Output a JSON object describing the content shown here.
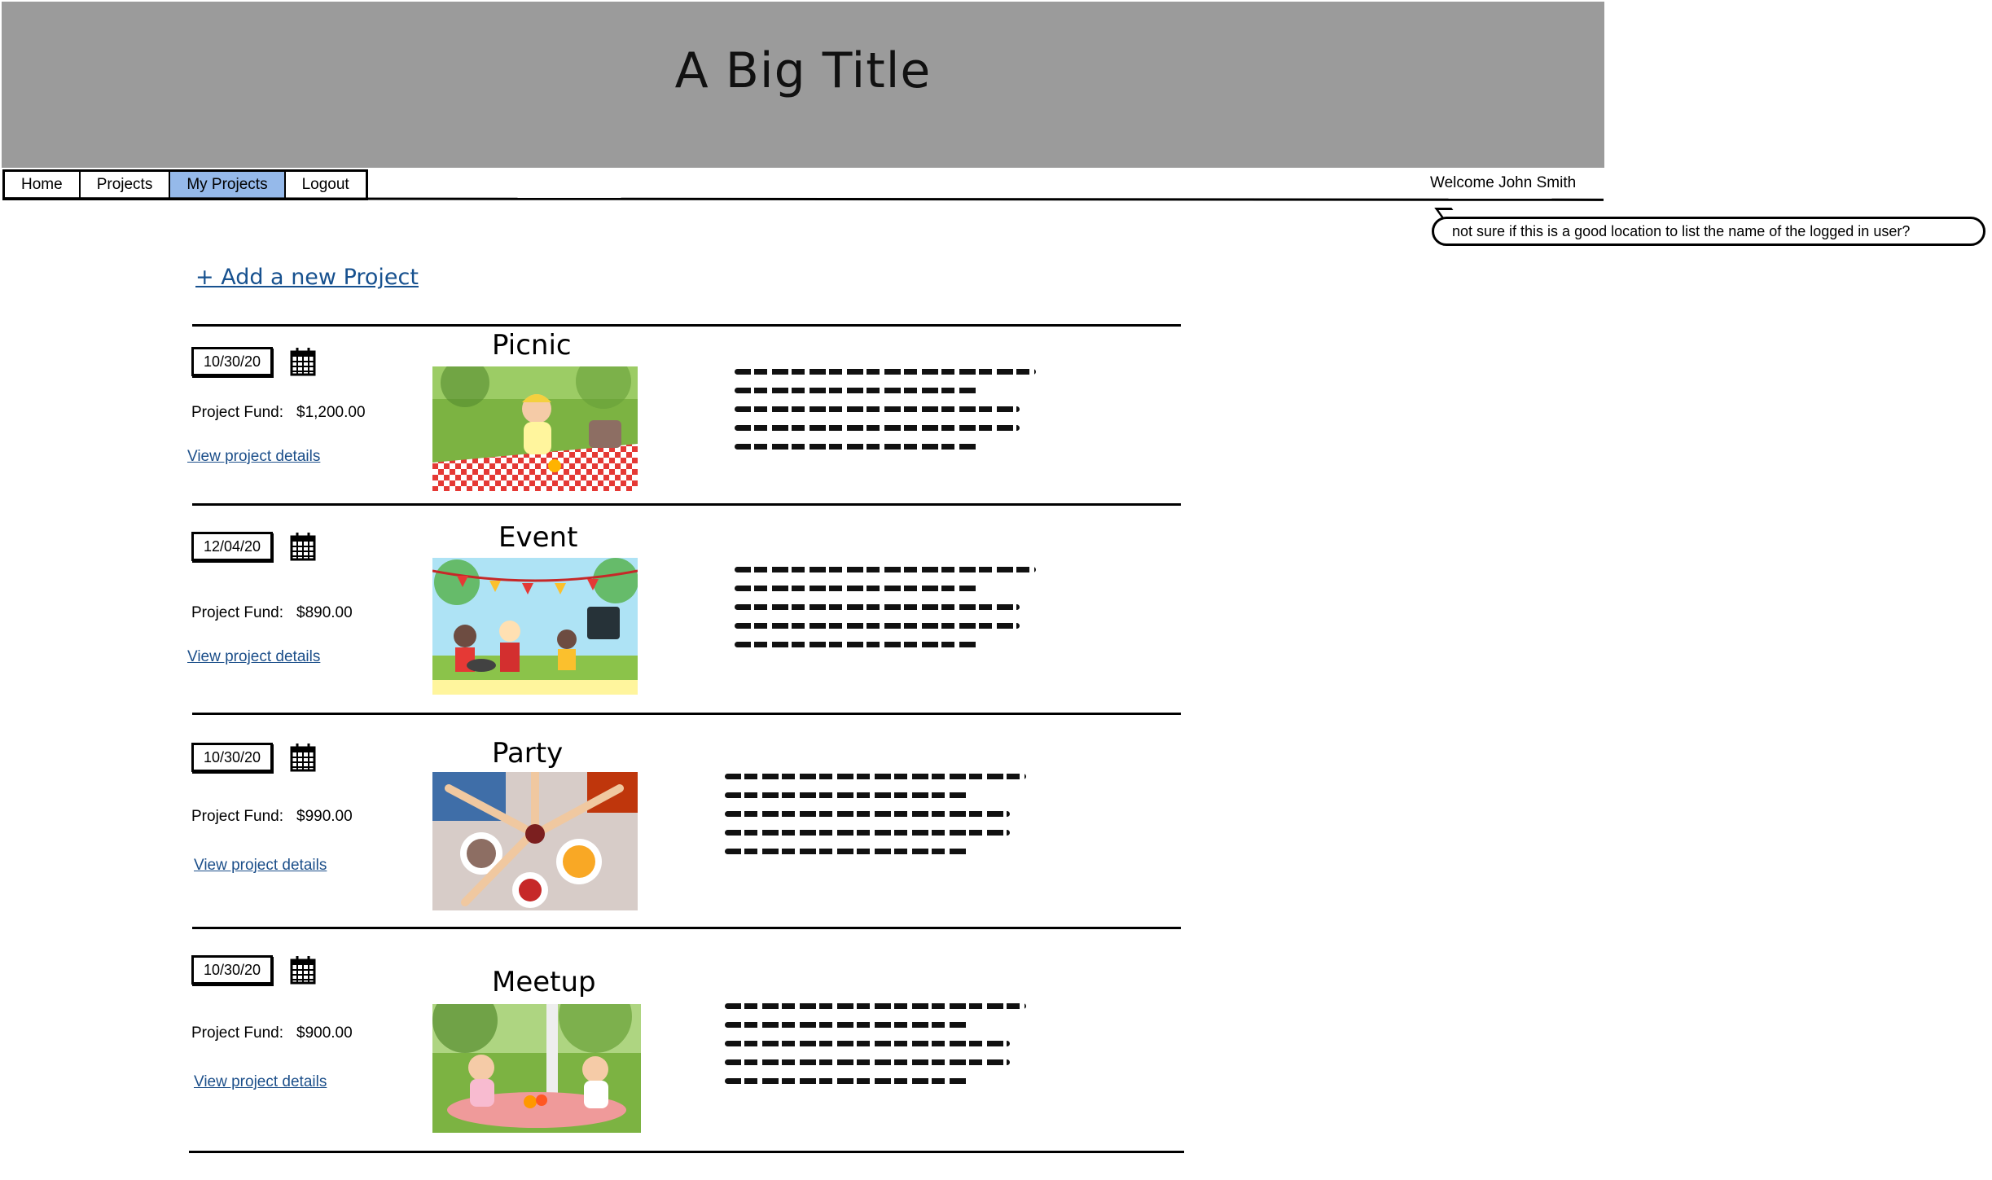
{
  "header": {
    "title": "A Big Title"
  },
  "nav": {
    "items": [
      {
        "label": "Home",
        "active": false
      },
      {
        "label": "Projects",
        "active": false
      },
      {
        "label": "My Projects",
        "active": true
      },
      {
        "label": "Logout",
        "active": false
      }
    ],
    "welcome": "Welcome John Smith"
  },
  "annotation": {
    "note": "not sure if this is a good location to list the name of the logged in user?"
  },
  "add_project_label": "+ Add a new Project",
  "fund_label": "Project Fund:",
  "details_label": "View project details",
  "projects": [
    {
      "title": "Picnic",
      "date": "10/30/20",
      "fund": "$1,200.00",
      "image": "picnic-photo"
    },
    {
      "title": "Event",
      "date": "12/04/20",
      "fund": "$890.00",
      "image": "bbq-picnic-illustration"
    },
    {
      "title": "Party",
      "date": "10/30/20",
      "fund": "$990.00",
      "image": "party-table-photo"
    },
    {
      "title": "Meetup",
      "date": "10/30/20",
      "fund": "$900.00",
      "image": "children-picnic-photo"
    }
  ],
  "colors": {
    "header_bg": "#9b9b9b",
    "nav_active": "#95b9ea",
    "link": "#1c4f8a"
  }
}
